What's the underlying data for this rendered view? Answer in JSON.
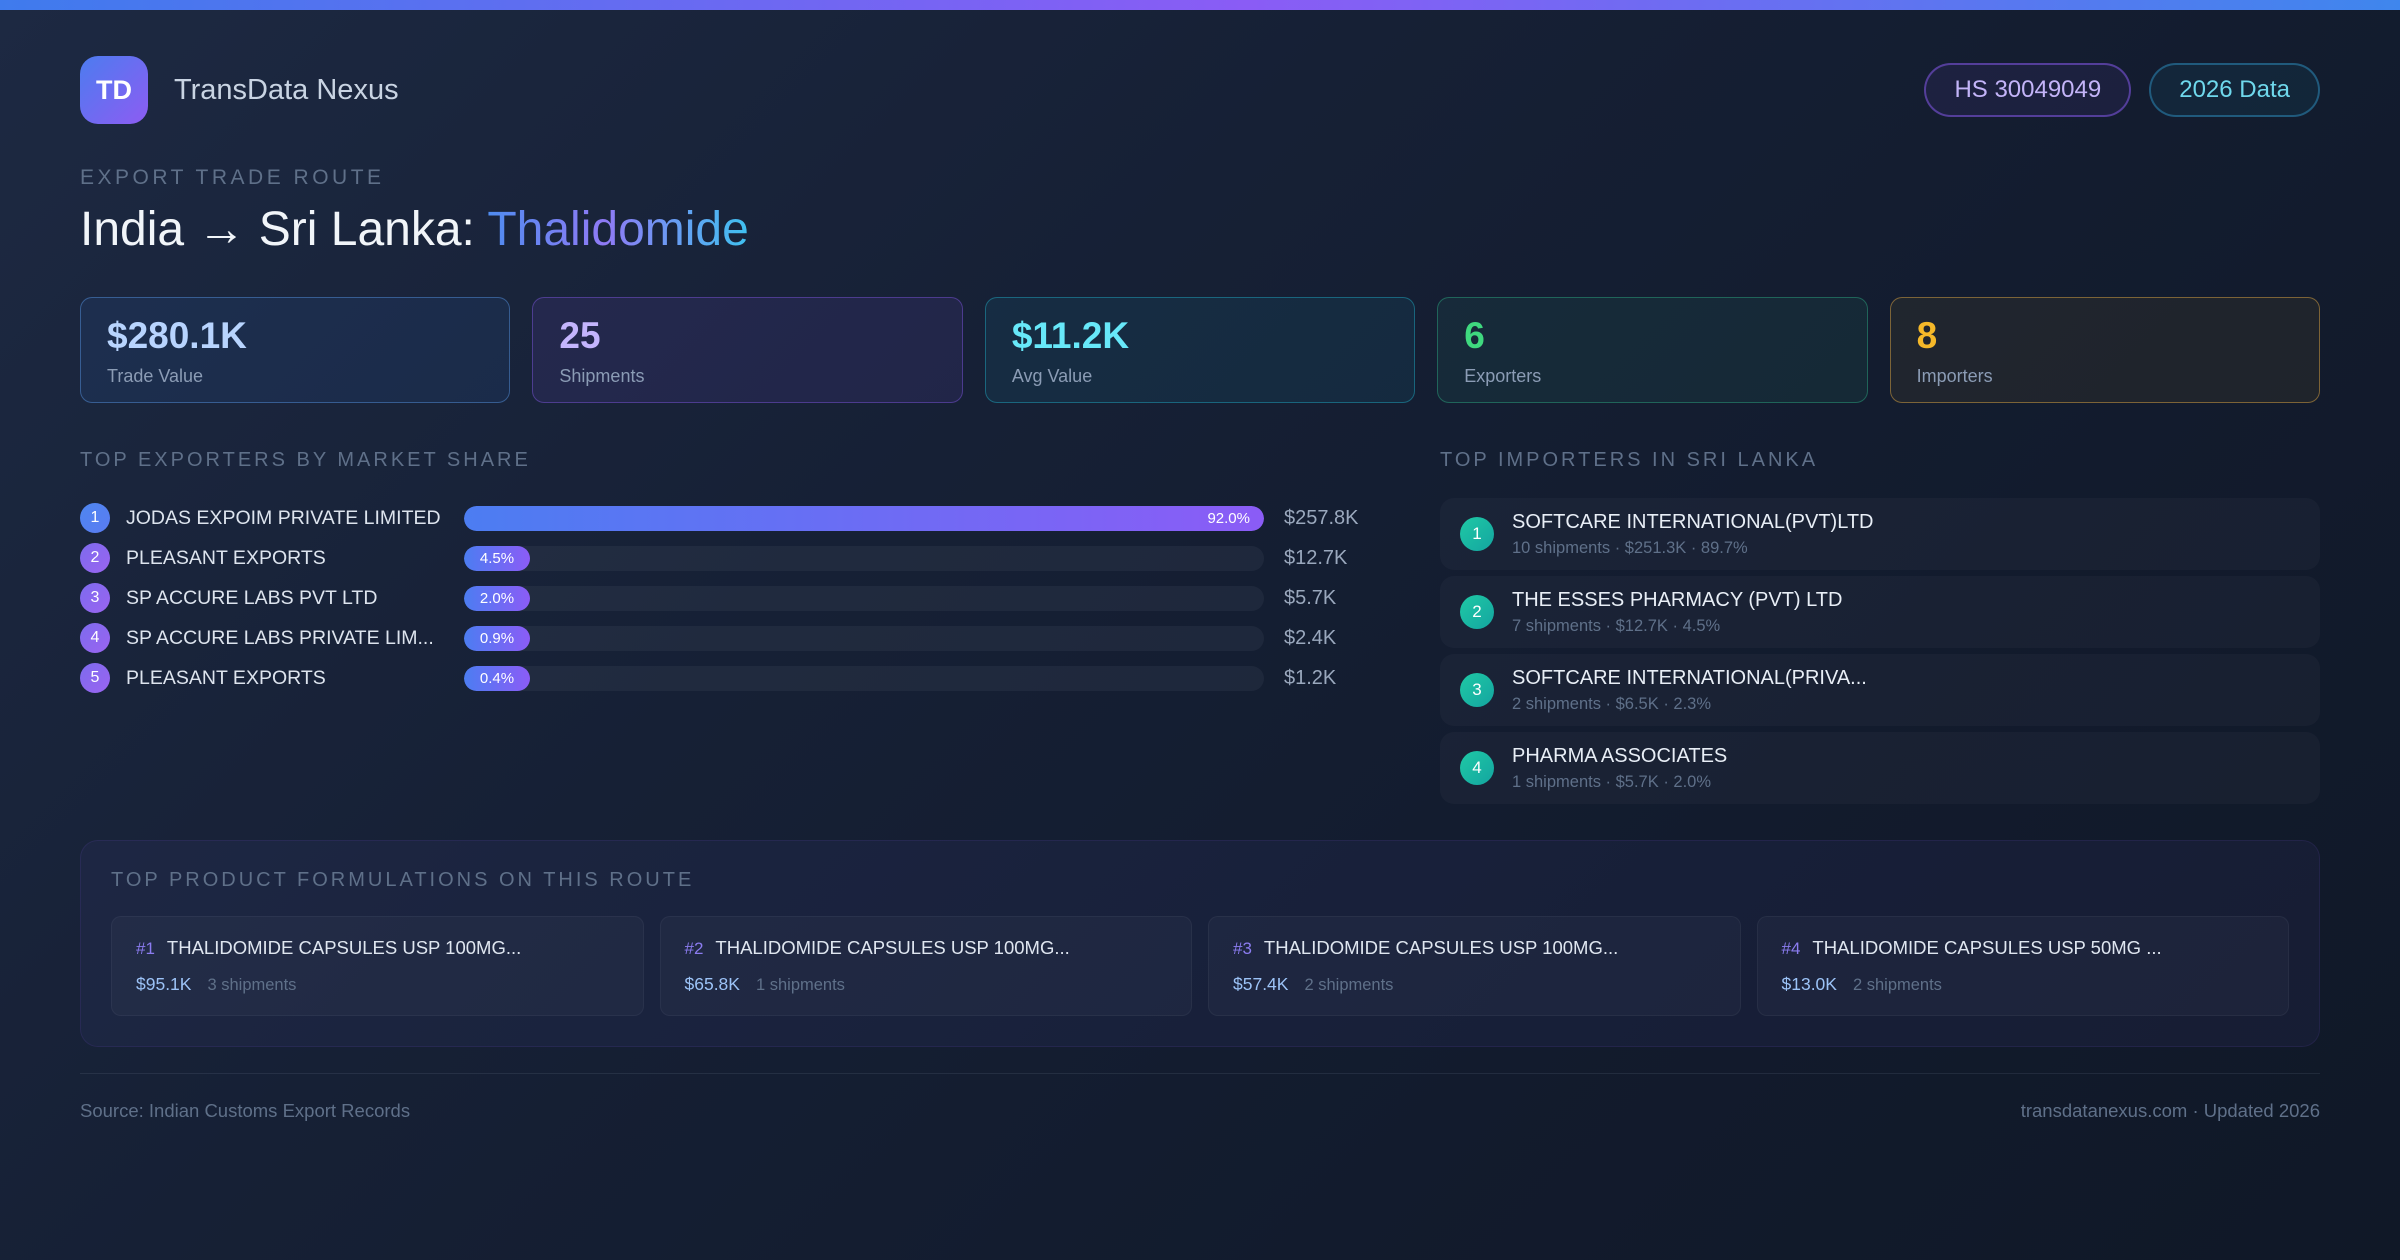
{
  "brand": {
    "logo": "TD",
    "name": "TransData Nexus"
  },
  "badges": {
    "hs_code": "HS 30049049",
    "year": "2026 Data"
  },
  "header": {
    "eyebrow": "EXPORT TRADE ROUTE",
    "title_route": "India → Sri Lanka:",
    "title_product": "Thalidomide"
  },
  "stats": [
    {
      "value": "$280.1K",
      "label": "Trade Value"
    },
    {
      "value": "25",
      "label": "Shipments"
    },
    {
      "value": "$11.2K",
      "label": "Avg Value"
    },
    {
      "value": "6",
      "label": "Exporters"
    },
    {
      "value": "8",
      "label": "Importers"
    }
  ],
  "exporters": {
    "section_title": "TOP EXPORTERS BY MARKET SHARE",
    "items": [
      {
        "rank": "1",
        "name": "JODAS EXPOIM PRIVATE LIMITED",
        "share_pct": 92.0,
        "share_label": "92.0%",
        "value": "$257.8K"
      },
      {
        "rank": "2",
        "name": "PLEASANT EXPORTS",
        "share_pct": 4.5,
        "share_label": "4.5%",
        "value": "$12.7K"
      },
      {
        "rank": "3",
        "name": "SP ACCURE LABS PVT LTD",
        "share_pct": 2.0,
        "share_label": "2.0%",
        "value": "$5.7K"
      },
      {
        "rank": "4",
        "name": "SP ACCURE LABS PRIVATE LIM...",
        "share_pct": 0.9,
        "share_label": "0.9%",
        "value": "$2.4K"
      },
      {
        "rank": "5",
        "name": "PLEASANT EXPORTS",
        "share_pct": 0.4,
        "share_label": "0.4%",
        "value": "$1.2K"
      }
    ]
  },
  "importers": {
    "section_title": "TOP IMPORTERS IN SRI LANKA",
    "items": [
      {
        "rank": "1",
        "name": "SOFTCARE INTERNATIONAL(PVT)LTD",
        "meta": "10 shipments · $251.3K · 89.7%"
      },
      {
        "rank": "2",
        "name": "THE ESSES PHARMACY (PVT) LTD",
        "meta": "7 shipments · $12.7K · 4.5%"
      },
      {
        "rank": "3",
        "name": "SOFTCARE INTERNATIONAL(PRIVA...",
        "meta": "2 shipments · $6.5K · 2.3%"
      },
      {
        "rank": "4",
        "name": "PHARMA ASSOCIATES",
        "meta": "1 shipments · $5.7K · 2.0%"
      }
    ]
  },
  "formulations": {
    "section_title": "TOP PRODUCT FORMULATIONS ON THIS ROUTE",
    "items": [
      {
        "rank": "#1",
        "name": "THALIDOMIDE CAPSULES USP 100MG...",
        "value": "$95.1K",
        "shipments": "3 shipments"
      },
      {
        "rank": "#2",
        "name": "THALIDOMIDE CAPSULES USP 100MG...",
        "value": "$65.8K",
        "shipments": "1 shipments"
      },
      {
        "rank": "#3",
        "name": "THALIDOMIDE CAPSULES USP 100MG...",
        "value": "$57.4K",
        "shipments": "2 shipments"
      },
      {
        "rank": "#4",
        "name": "THALIDOMIDE CAPSULES USP 50MG ...",
        "value": "$13.0K",
        "shipments": "2 shipments"
      }
    ]
  },
  "footer": {
    "source": "Source: Indian Customs Export Records",
    "site": "transdatanexus.com · Updated 2026"
  },
  "colors": {
    "accent_blue": "#4c7df2",
    "accent_purple": "#8b5cf6",
    "accent_cyan": "#67e8f9",
    "accent_green": "#3fd97f",
    "accent_amber": "#f5b829",
    "accent_teal": "#1fc9a5",
    "background": "#131c2e"
  }
}
